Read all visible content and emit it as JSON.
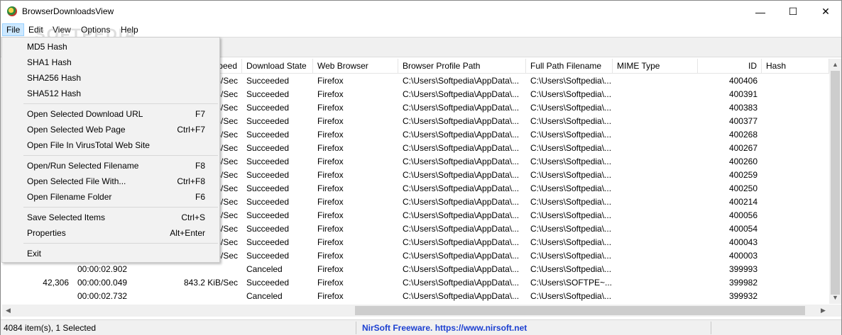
{
  "window": {
    "title": "BrowserDownloadsView",
    "minimize": "—",
    "maximize": "☐",
    "close": "✕"
  },
  "watermark": "SOFTPEDIA",
  "menubar": [
    "File",
    "Edit",
    "View",
    "Options",
    "Help"
  ],
  "file_menu": {
    "groups": [
      [
        {
          "label": "MD5 Hash",
          "key": ""
        },
        {
          "label": "SHA1 Hash",
          "key": ""
        },
        {
          "label": "SHA256 Hash",
          "key": ""
        },
        {
          "label": "SHA512 Hash",
          "key": ""
        }
      ],
      [
        {
          "label": "Open Selected Download URL",
          "key": "F7"
        },
        {
          "label": "Open Selected Web Page",
          "key": "Ctrl+F7"
        },
        {
          "label": "Open File In VirusTotal Web Site",
          "key": ""
        }
      ],
      [
        {
          "label": "Open/Run Selected Filename",
          "key": "F8"
        },
        {
          "label": "Open Selected File With...",
          "key": "Ctrl+F8"
        },
        {
          "label": "Open Filename Folder",
          "key": "F6"
        }
      ],
      [
        {
          "label": "Save Selected Items",
          "key": "Ctrl+S"
        },
        {
          "label": "Properties",
          "key": "Alt+Enter"
        }
      ],
      [
        {
          "label": "Exit",
          "key": ""
        }
      ]
    ]
  },
  "columns": [
    {
      "key": "size",
      "label": ""
    },
    {
      "key": "time",
      "label": ""
    },
    {
      "key": "speed",
      "label": "peed"
    },
    {
      "key": "state",
      "label": "Download State"
    },
    {
      "key": "browser",
      "label": "Web Browser"
    },
    {
      "key": "profile",
      "label": "Browser Profile Path"
    },
    {
      "key": "path",
      "label": "Full Path Filename"
    },
    {
      "key": "mime",
      "label": "MIME Type"
    },
    {
      "key": "id",
      "label": "ID"
    },
    {
      "key": "hash",
      "label": "Hash"
    }
  ],
  "rows": [
    {
      "size": "",
      "time": "",
      "speed": "B/Sec",
      "state": "Succeeded",
      "browser": "Firefox",
      "profile": "C:\\Users\\Softpedia\\AppData\\...",
      "path": "C:\\Users\\Softpedia\\...",
      "mime": "",
      "id": "400406",
      "hash": ""
    },
    {
      "size": "",
      "time": "",
      "speed": "B/Sec",
      "state": "Succeeded",
      "browser": "Firefox",
      "profile": "C:\\Users\\Softpedia\\AppData\\...",
      "path": "C:\\Users\\Softpedia\\...",
      "mime": "",
      "id": "400391",
      "hash": ""
    },
    {
      "size": "",
      "time": "",
      "speed": "B/Sec",
      "state": "Succeeded",
      "browser": "Firefox",
      "profile": "C:\\Users\\Softpedia\\AppData\\...",
      "path": "C:\\Users\\Softpedia\\...",
      "mime": "",
      "id": "400383",
      "hash": ""
    },
    {
      "size": "",
      "time": "",
      "speed": "B/Sec",
      "state": "Succeeded",
      "browser": "Firefox",
      "profile": "C:\\Users\\Softpedia\\AppData\\...",
      "path": "C:\\Users\\Softpedia\\...",
      "mime": "",
      "id": "400377",
      "hash": ""
    },
    {
      "size": "",
      "time": "",
      "speed": "B/Sec",
      "state": "Succeeded",
      "browser": "Firefox",
      "profile": "C:\\Users\\Softpedia\\AppData\\...",
      "path": "C:\\Users\\Softpedia\\...",
      "mime": "",
      "id": "400268",
      "hash": ""
    },
    {
      "size": "",
      "time": "",
      "speed": "B/Sec",
      "state": "Succeeded",
      "browser": "Firefox",
      "profile": "C:\\Users\\Softpedia\\AppData\\...",
      "path": "C:\\Users\\Softpedia\\...",
      "mime": "",
      "id": "400267",
      "hash": ""
    },
    {
      "size": "",
      "time": "",
      "speed": "B/Sec",
      "state": "Succeeded",
      "browser": "Firefox",
      "profile": "C:\\Users\\Softpedia\\AppData\\...",
      "path": "C:\\Users\\Softpedia\\...",
      "mime": "",
      "id": "400260",
      "hash": ""
    },
    {
      "size": "",
      "time": "",
      "speed": "B/Sec",
      "state": "Succeeded",
      "browser": "Firefox",
      "profile": "C:\\Users\\Softpedia\\AppData\\...",
      "path": "C:\\Users\\Softpedia\\...",
      "mime": "",
      "id": "400259",
      "hash": ""
    },
    {
      "size": "",
      "time": "",
      "speed": "B/Sec",
      "state": "Succeeded",
      "browser": "Firefox",
      "profile": "C:\\Users\\Softpedia\\AppData\\...",
      "path": "C:\\Users\\Softpedia\\...",
      "mime": "",
      "id": "400250",
      "hash": ""
    },
    {
      "size": "",
      "time": "",
      "speed": "B/Sec",
      "state": "Succeeded",
      "browser": "Firefox",
      "profile": "C:\\Users\\Softpedia\\AppData\\...",
      "path": "C:\\Users\\Softpedia\\...",
      "mime": "",
      "id": "400214",
      "hash": ""
    },
    {
      "size": "",
      "time": "",
      "speed": "B/Sec",
      "state": "Succeeded",
      "browser": "Firefox",
      "profile": "C:\\Users\\Softpedia\\AppData\\...",
      "path": "C:\\Users\\Softpedia\\...",
      "mime": "",
      "id": "400056",
      "hash": ""
    },
    {
      "size": "",
      "time": "",
      "speed": "B/Sec",
      "state": "Succeeded",
      "browser": "Firefox",
      "profile": "C:\\Users\\Softpedia\\AppData\\...",
      "path": "C:\\Users\\Softpedia\\...",
      "mime": "",
      "id": "400054",
      "hash": ""
    },
    {
      "size": "",
      "time": "",
      "speed": "B/Sec",
      "state": "Succeeded",
      "browser": "Firefox",
      "profile": "C:\\Users\\Softpedia\\AppData\\...",
      "path": "C:\\Users\\Softpedia\\...",
      "mime": "",
      "id": "400043",
      "hash": ""
    },
    {
      "size": "",
      "time": "",
      "speed": "B/Sec",
      "state": "Succeeded",
      "browser": "Firefox",
      "profile": "C:\\Users\\Softpedia\\AppData\\...",
      "path": "C:\\Users\\Softpedia\\...",
      "mime": "",
      "id": "400003",
      "hash": ""
    },
    {
      "size": "",
      "time": "00:00:02.902",
      "speed": "",
      "state": "Canceled",
      "browser": "Firefox",
      "profile": "C:\\Users\\Softpedia\\AppData\\...",
      "path": "C:\\Users\\Softpedia\\...",
      "mime": "",
      "id": "399993",
      "hash": ""
    },
    {
      "size": "42,306",
      "time": "00:00:00.049",
      "speed": "843.2 KiB/Sec",
      "state": "Succeeded",
      "browser": "Firefox",
      "profile": "C:\\Users\\Softpedia\\AppData\\...",
      "path": "C:\\Users\\SOFTPE~...",
      "mime": "",
      "id": "399982",
      "hash": ""
    },
    {
      "size": "",
      "time": "00:00:02.732",
      "speed": "",
      "state": "Canceled",
      "browser": "Firefox",
      "profile": "C:\\Users\\Softpedia\\AppData\\...",
      "path": "C:\\Users\\Softpedia\\...",
      "mime": "",
      "id": "399932",
      "hash": ""
    }
  ],
  "status": {
    "count": "4084 item(s), 1 Selected",
    "link": "NirSoft Freeware. https://www.nirsoft.net"
  }
}
